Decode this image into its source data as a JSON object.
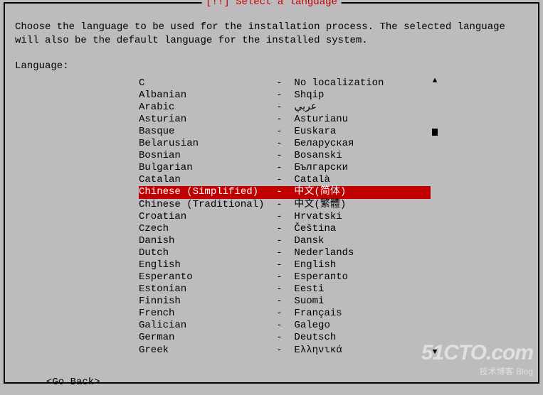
{
  "dialog": {
    "title": "[!!] Select a language",
    "instruction": "Choose the language to be used for the installation process. The selected language will also be the default language for the installed system.",
    "label": "Language:",
    "go_back": "<Go Back>",
    "selected_index": 9,
    "languages": [
      {
        "name": "C",
        "native": "No localization"
      },
      {
        "name": "Albanian",
        "native": "Shqip"
      },
      {
        "name": "Arabic",
        "native": "عربي"
      },
      {
        "name": "Asturian",
        "native": "Asturianu"
      },
      {
        "name": "Basque",
        "native": "Euskara"
      },
      {
        "name": "Belarusian",
        "native": "Беларуская"
      },
      {
        "name": "Bosnian",
        "native": "Bosanski"
      },
      {
        "name": "Bulgarian",
        "native": "Български"
      },
      {
        "name": "Catalan",
        "native": "Català"
      },
      {
        "name": "Chinese (Simplified)",
        "native": "中文(简体)"
      },
      {
        "name": "Chinese (Traditional)",
        "native": "中文(繁體)"
      },
      {
        "name": "Croatian",
        "native": "Hrvatski"
      },
      {
        "name": "Czech",
        "native": "Čeština"
      },
      {
        "name": "Danish",
        "native": "Dansk"
      },
      {
        "name": "Dutch",
        "native": "Nederlands"
      },
      {
        "name": "English",
        "native": "English"
      },
      {
        "name": "Esperanto",
        "native": "Esperanto"
      },
      {
        "name": "Estonian",
        "native": "Eesti"
      },
      {
        "name": "Finnish",
        "native": "Suomi"
      },
      {
        "name": "French",
        "native": "Français"
      },
      {
        "name": "Galician",
        "native": "Galego"
      },
      {
        "name": "German",
        "native": "Deutsch"
      },
      {
        "name": "Greek",
        "native": "Ελληνικά"
      }
    ]
  },
  "watermark": {
    "big": "51CTO.com",
    "small": "技术博客      Blog"
  }
}
